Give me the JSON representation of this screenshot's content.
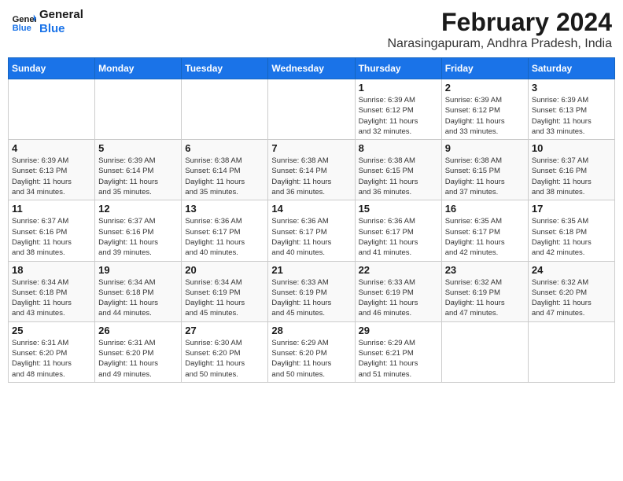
{
  "logo": {
    "line1": "General",
    "line2": "Blue"
  },
  "title": {
    "month_year": "February 2024",
    "location": "Narasingapuram, Andhra Pradesh, India"
  },
  "headers": [
    "Sunday",
    "Monday",
    "Tuesday",
    "Wednesday",
    "Thursday",
    "Friday",
    "Saturday"
  ],
  "weeks": [
    [
      {
        "day": "",
        "info": ""
      },
      {
        "day": "",
        "info": ""
      },
      {
        "day": "",
        "info": ""
      },
      {
        "day": "",
        "info": ""
      },
      {
        "day": "1",
        "info": "Sunrise: 6:39 AM\nSunset: 6:12 PM\nDaylight: 11 hours\nand 32 minutes."
      },
      {
        "day": "2",
        "info": "Sunrise: 6:39 AM\nSunset: 6:12 PM\nDaylight: 11 hours\nand 33 minutes."
      },
      {
        "day": "3",
        "info": "Sunrise: 6:39 AM\nSunset: 6:13 PM\nDaylight: 11 hours\nand 33 minutes."
      }
    ],
    [
      {
        "day": "4",
        "info": "Sunrise: 6:39 AM\nSunset: 6:13 PM\nDaylight: 11 hours\nand 34 minutes."
      },
      {
        "day": "5",
        "info": "Sunrise: 6:39 AM\nSunset: 6:14 PM\nDaylight: 11 hours\nand 35 minutes."
      },
      {
        "day": "6",
        "info": "Sunrise: 6:38 AM\nSunset: 6:14 PM\nDaylight: 11 hours\nand 35 minutes."
      },
      {
        "day": "7",
        "info": "Sunrise: 6:38 AM\nSunset: 6:14 PM\nDaylight: 11 hours\nand 36 minutes."
      },
      {
        "day": "8",
        "info": "Sunrise: 6:38 AM\nSunset: 6:15 PM\nDaylight: 11 hours\nand 36 minutes."
      },
      {
        "day": "9",
        "info": "Sunrise: 6:38 AM\nSunset: 6:15 PM\nDaylight: 11 hours\nand 37 minutes."
      },
      {
        "day": "10",
        "info": "Sunrise: 6:37 AM\nSunset: 6:16 PM\nDaylight: 11 hours\nand 38 minutes."
      }
    ],
    [
      {
        "day": "11",
        "info": "Sunrise: 6:37 AM\nSunset: 6:16 PM\nDaylight: 11 hours\nand 38 minutes."
      },
      {
        "day": "12",
        "info": "Sunrise: 6:37 AM\nSunset: 6:16 PM\nDaylight: 11 hours\nand 39 minutes."
      },
      {
        "day": "13",
        "info": "Sunrise: 6:36 AM\nSunset: 6:17 PM\nDaylight: 11 hours\nand 40 minutes."
      },
      {
        "day": "14",
        "info": "Sunrise: 6:36 AM\nSunset: 6:17 PM\nDaylight: 11 hours\nand 40 minutes."
      },
      {
        "day": "15",
        "info": "Sunrise: 6:36 AM\nSunset: 6:17 PM\nDaylight: 11 hours\nand 41 minutes."
      },
      {
        "day": "16",
        "info": "Sunrise: 6:35 AM\nSunset: 6:17 PM\nDaylight: 11 hours\nand 42 minutes."
      },
      {
        "day": "17",
        "info": "Sunrise: 6:35 AM\nSunset: 6:18 PM\nDaylight: 11 hours\nand 42 minutes."
      }
    ],
    [
      {
        "day": "18",
        "info": "Sunrise: 6:34 AM\nSunset: 6:18 PM\nDaylight: 11 hours\nand 43 minutes."
      },
      {
        "day": "19",
        "info": "Sunrise: 6:34 AM\nSunset: 6:18 PM\nDaylight: 11 hours\nand 44 minutes."
      },
      {
        "day": "20",
        "info": "Sunrise: 6:34 AM\nSunset: 6:19 PM\nDaylight: 11 hours\nand 45 minutes."
      },
      {
        "day": "21",
        "info": "Sunrise: 6:33 AM\nSunset: 6:19 PM\nDaylight: 11 hours\nand 45 minutes."
      },
      {
        "day": "22",
        "info": "Sunrise: 6:33 AM\nSunset: 6:19 PM\nDaylight: 11 hours\nand 46 minutes."
      },
      {
        "day": "23",
        "info": "Sunrise: 6:32 AM\nSunset: 6:19 PM\nDaylight: 11 hours\nand 47 minutes."
      },
      {
        "day": "24",
        "info": "Sunrise: 6:32 AM\nSunset: 6:20 PM\nDaylight: 11 hours\nand 47 minutes."
      }
    ],
    [
      {
        "day": "25",
        "info": "Sunrise: 6:31 AM\nSunset: 6:20 PM\nDaylight: 11 hours\nand 48 minutes."
      },
      {
        "day": "26",
        "info": "Sunrise: 6:31 AM\nSunset: 6:20 PM\nDaylight: 11 hours\nand 49 minutes."
      },
      {
        "day": "27",
        "info": "Sunrise: 6:30 AM\nSunset: 6:20 PM\nDaylight: 11 hours\nand 50 minutes."
      },
      {
        "day": "28",
        "info": "Sunrise: 6:29 AM\nSunset: 6:20 PM\nDaylight: 11 hours\nand 50 minutes."
      },
      {
        "day": "29",
        "info": "Sunrise: 6:29 AM\nSunset: 6:21 PM\nDaylight: 11 hours\nand 51 minutes."
      },
      {
        "day": "",
        "info": ""
      },
      {
        "day": "",
        "info": ""
      }
    ]
  ]
}
